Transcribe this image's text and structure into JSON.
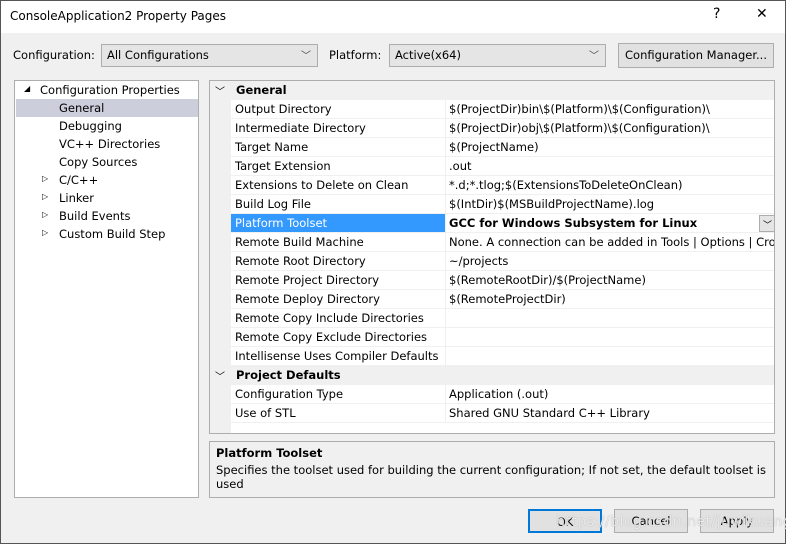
{
  "window": {
    "title": "ConsoleApplication2 Property Pages",
    "help": "?",
    "close": "✕"
  },
  "toolbar": {
    "configuration_label": "Configuration:",
    "configuration_value": "All Configurations",
    "platform_label": "Platform:",
    "platform_value": "Active(x64)",
    "config_manager": "Configuration Manager..."
  },
  "tree": {
    "root": "Configuration Properties",
    "items": [
      {
        "label": "General",
        "expandable": false,
        "selected": true
      },
      {
        "label": "Debugging",
        "expandable": false
      },
      {
        "label": "VC++ Directories",
        "expandable": false
      },
      {
        "label": "Copy Sources",
        "expandable": false
      },
      {
        "label": "C/C++",
        "expandable": true
      },
      {
        "label": "Linker",
        "expandable": true
      },
      {
        "label": "Build Events",
        "expandable": true
      },
      {
        "label": "Custom Build Step",
        "expandable": true
      }
    ]
  },
  "grid": {
    "categories": [
      {
        "title": "General",
        "rows": [
          {
            "k": "Output Directory",
            "v": "$(ProjectDir)bin\\$(Platform)\\$(Configuration)\\"
          },
          {
            "k": "Intermediate Directory",
            "v": "$(ProjectDir)obj\\$(Platform)\\$(Configuration)\\"
          },
          {
            "k": "Target Name",
            "v": "$(ProjectName)"
          },
          {
            "k": "Target Extension",
            "v": ".out"
          },
          {
            "k": "Extensions to Delete on Clean",
            "v": "*.d;*.tlog;$(ExtensionsToDeleteOnClean)"
          },
          {
            "k": "Build Log File",
            "v": "$(IntDir)$(MSBuildProjectName).log"
          },
          {
            "k": "Platform Toolset",
            "v": "GCC for Windows Subsystem for Linux",
            "selected": true
          },
          {
            "k": "Remote Build Machine",
            "v": "None. A connection can be added in Tools | Options | Cross Platform"
          },
          {
            "k": "Remote Root Directory",
            "v": "~/projects"
          },
          {
            "k": "Remote Project Directory",
            "v": "$(RemoteRootDir)/$(ProjectName)"
          },
          {
            "k": "Remote Deploy Directory",
            "v": "$(RemoteProjectDir)"
          },
          {
            "k": "Remote Copy Include Directories",
            "v": ""
          },
          {
            "k": "Remote Copy Exclude Directories",
            "v": ""
          },
          {
            "k": "Intellisense Uses Compiler Defaults",
            "v": ""
          }
        ]
      },
      {
        "title": "Project Defaults",
        "rows": [
          {
            "k": "Configuration Type",
            "v": "Application (.out)"
          },
          {
            "k": "Use of STL",
            "v": "Shared GNU Standard C++ Library"
          }
        ]
      }
    ]
  },
  "description": {
    "title": "Platform Toolset",
    "text": "Specifies the toolset used for building the current configuration; If not set, the default toolset is used"
  },
  "buttons": {
    "ok": "OK",
    "cancel": "Cancel",
    "apply": "Apply"
  },
  "watermark": "https://blog.csdn.net/juwikuang",
  "colors": {
    "selection": "#3399ff",
    "tree_selection": "#cccedb",
    "focus": "#0078d7"
  }
}
